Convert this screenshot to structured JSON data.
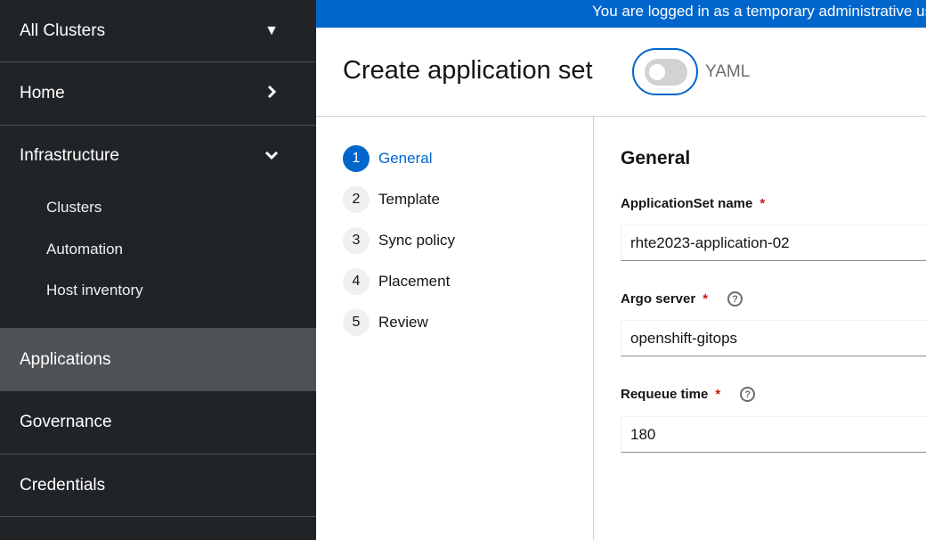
{
  "banner": {
    "text": "You are logged in as a temporary administrative user"
  },
  "sidebar": {
    "cluster_switcher": "All Clusters",
    "items": [
      {
        "label": "Home"
      },
      {
        "label": "Infrastructure"
      },
      {
        "label": "Applications"
      },
      {
        "label": "Governance"
      },
      {
        "label": "Credentials"
      }
    ],
    "infra_sub": [
      {
        "label": "Clusters"
      },
      {
        "label": "Automation"
      },
      {
        "label": "Host inventory"
      }
    ]
  },
  "header": {
    "title": "Create application set",
    "yaml_label": "YAML",
    "yaml_on": false
  },
  "wizard": {
    "steps": [
      {
        "num": "1",
        "label": "General"
      },
      {
        "num": "2",
        "label": "Template"
      },
      {
        "num": "3",
        "label": "Sync policy"
      },
      {
        "num": "4",
        "label": "Placement"
      },
      {
        "num": "5",
        "label": "Review"
      }
    ]
  },
  "form": {
    "heading": "General",
    "required_mark": "*",
    "help_glyph": "?",
    "fields": [
      {
        "label": "ApplicationSet name",
        "value": "rhte2023-application-02"
      },
      {
        "label": "Argo server",
        "value": "openshift-gitops"
      },
      {
        "label": "Requeue time",
        "value": "180"
      }
    ]
  },
  "colors": {
    "accent": "#0066cc",
    "sidebar_bg": "#212427",
    "active_nav": "#4f5255",
    "required": "#c9190b"
  }
}
